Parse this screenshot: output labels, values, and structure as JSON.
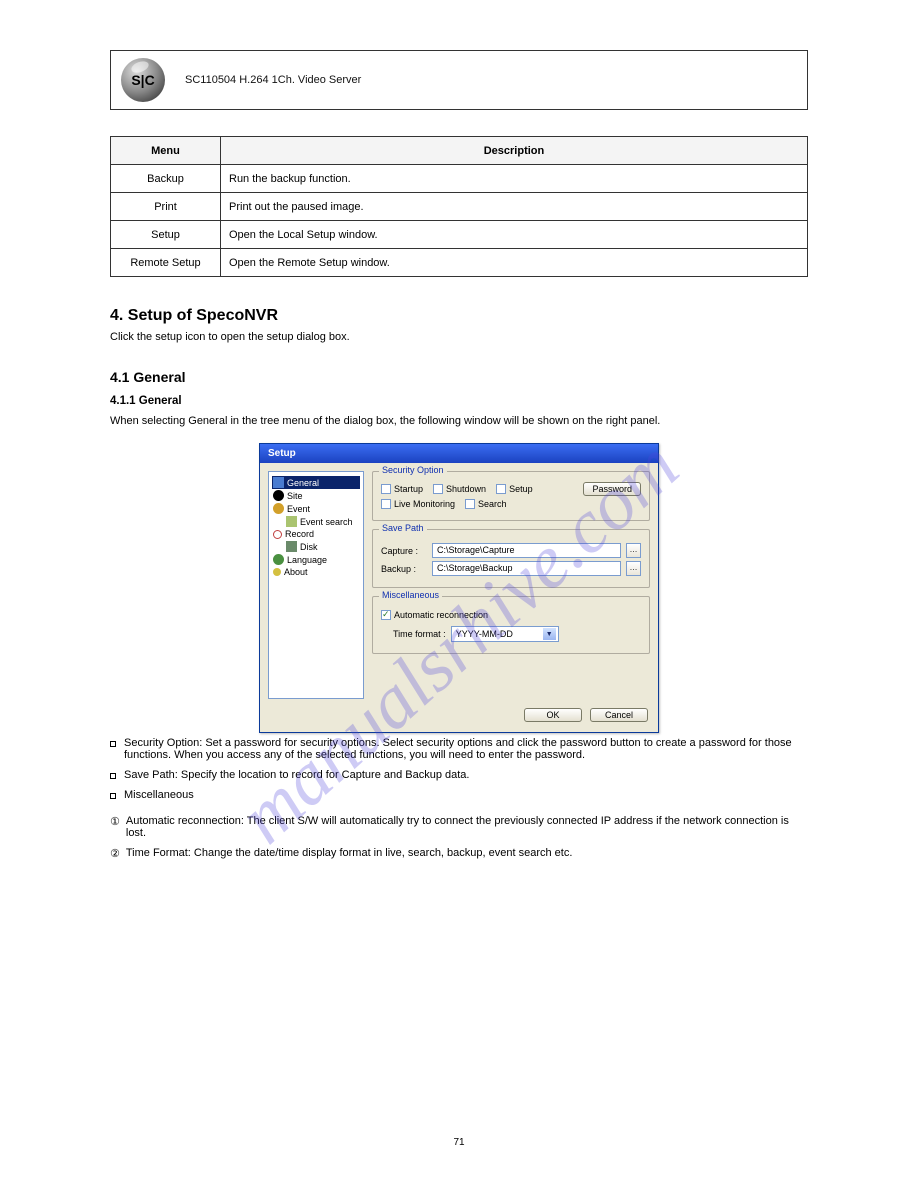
{
  "header": {
    "logo_text": "S|C",
    "title": "SC110504 H.264 1Ch. Video Server"
  },
  "table": {
    "col1": "Menu",
    "col2": "Description",
    "rows": [
      {
        "c1": "Backup",
        "c2": "Run the backup function."
      },
      {
        "c1": "Print",
        "c2": "Print out the paused image."
      },
      {
        "c1": "Setup",
        "c2": "Open the Local Setup window."
      },
      {
        "c1": "Remote Setup",
        "c2": "Open the Remote Setup window."
      }
    ]
  },
  "sections": {
    "title": "4. Setup of SpecoNVR",
    "intro": "Click the setup icon to open the setup dialog box.",
    "h1": "4.1 General",
    "h1a": "4.1.1 General",
    "h1a_body": "When selecting General in the tree menu of the dialog box, the following window will be shown on the right panel."
  },
  "dialog": {
    "title": "Setup",
    "tree": {
      "general": "General",
      "site": "Site",
      "event": "Event",
      "event_search": "Event search",
      "record": "Record",
      "disk": "Disk",
      "language": "Language",
      "about": "About"
    },
    "security": {
      "legend": "Security Option",
      "startup": "Startup",
      "shutdown": "Shutdown",
      "setup": "Setup",
      "live": "Live Monitoring",
      "search": "Search",
      "password_btn": "Password"
    },
    "savepath": {
      "legend": "Save Path",
      "capture_label": "Capture :",
      "backup_label": "Backup :",
      "capture_value": "C:\\Storage\\Capture",
      "backup_value": "C:\\Storage\\Backup"
    },
    "misc": {
      "legend": "Miscellaneous",
      "auto_label": "Automatic reconnection",
      "time_label": "Time format :",
      "time_value": "YYYY-MM-DD"
    },
    "footer": {
      "ok": "OK",
      "cancel": "Cancel"
    }
  },
  "bullets": [
    {
      "t": "Security Option: Set a password for security options. Select security options and click the password button to create a password for those functions. When you access any of the selected functions, you will need to enter the password."
    },
    {
      "t": "Save Path: Specify the location to record for Capture and Backup data."
    },
    {
      "t": "Miscellaneous"
    }
  ],
  "footitems": [
    {
      "n": "①",
      "t": "Automatic reconnection: The client S/W will automatically try to connect the previously connected IP address if the network connection is lost."
    },
    {
      "n": "②",
      "t": "Time Format: Change the date/time display format in live, search, backup, event search etc."
    }
  ],
  "watermark": "manualsrhive.com",
  "page_number": "71"
}
